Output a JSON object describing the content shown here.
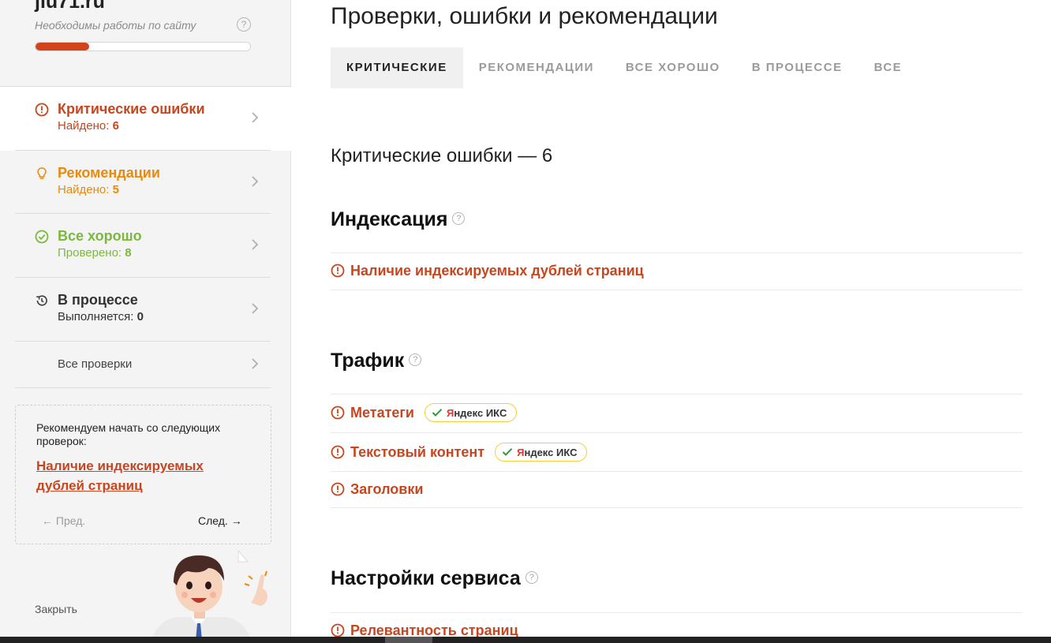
{
  "sidebar": {
    "site_name": "jlu71.ru",
    "site_subtitle": "Необходимы работы по сайту",
    "progress_percent": 25,
    "colors": {
      "critical": "#c8461f",
      "recommend": "#e98a0c",
      "ok": "#7cb83c",
      "process": "#444444"
    },
    "nav": {
      "critical": {
        "title": "Критические ошибки",
        "sub_label": "Найдено: ",
        "sub_value": "6"
      },
      "recommend": {
        "title": "Рекомендации",
        "sub_label": "Найдено: ",
        "sub_value": "5"
      },
      "ok": {
        "title": "Все хорошо",
        "sub_label": "Проверено: ",
        "sub_value": "8"
      },
      "process": {
        "title": "В процессе",
        "sub_label": "Выполняется: ",
        "sub_value": "0"
      },
      "all": {
        "title": "Все проверки"
      }
    },
    "recommend_box": {
      "text": "Рекомендуем начать со следующих проверок:",
      "link": "Наличие индексируемых дублей страниц",
      "prev": "← Пред.",
      "next": "След. →"
    },
    "close": "Закрыть"
  },
  "main": {
    "title": "Проверки, ошибки и рекомендации",
    "tabs": [
      "КРИТИЧЕСКИЕ",
      "РЕКОМЕНДАЦИИ",
      "ВСЕ ХОРОШО",
      "В ПРОЦЕССЕ",
      "ВСЕ"
    ],
    "section_count": "Критические ошибки — 6",
    "groups": {
      "indexing": {
        "title": "Индексация",
        "items": [
          "Наличие индексируемых дублей страниц"
        ]
      },
      "traffic": {
        "title": "Трафик",
        "items": [
          "Метатеги",
          "Текстовый контент",
          "Заголовки"
        ]
      },
      "settings": {
        "title": "Настройки сервиса",
        "items": [
          "Релевантность страниц"
        ]
      }
    },
    "badge": {
      "ya": "Я",
      "rest": "ндекс ИКС"
    }
  }
}
